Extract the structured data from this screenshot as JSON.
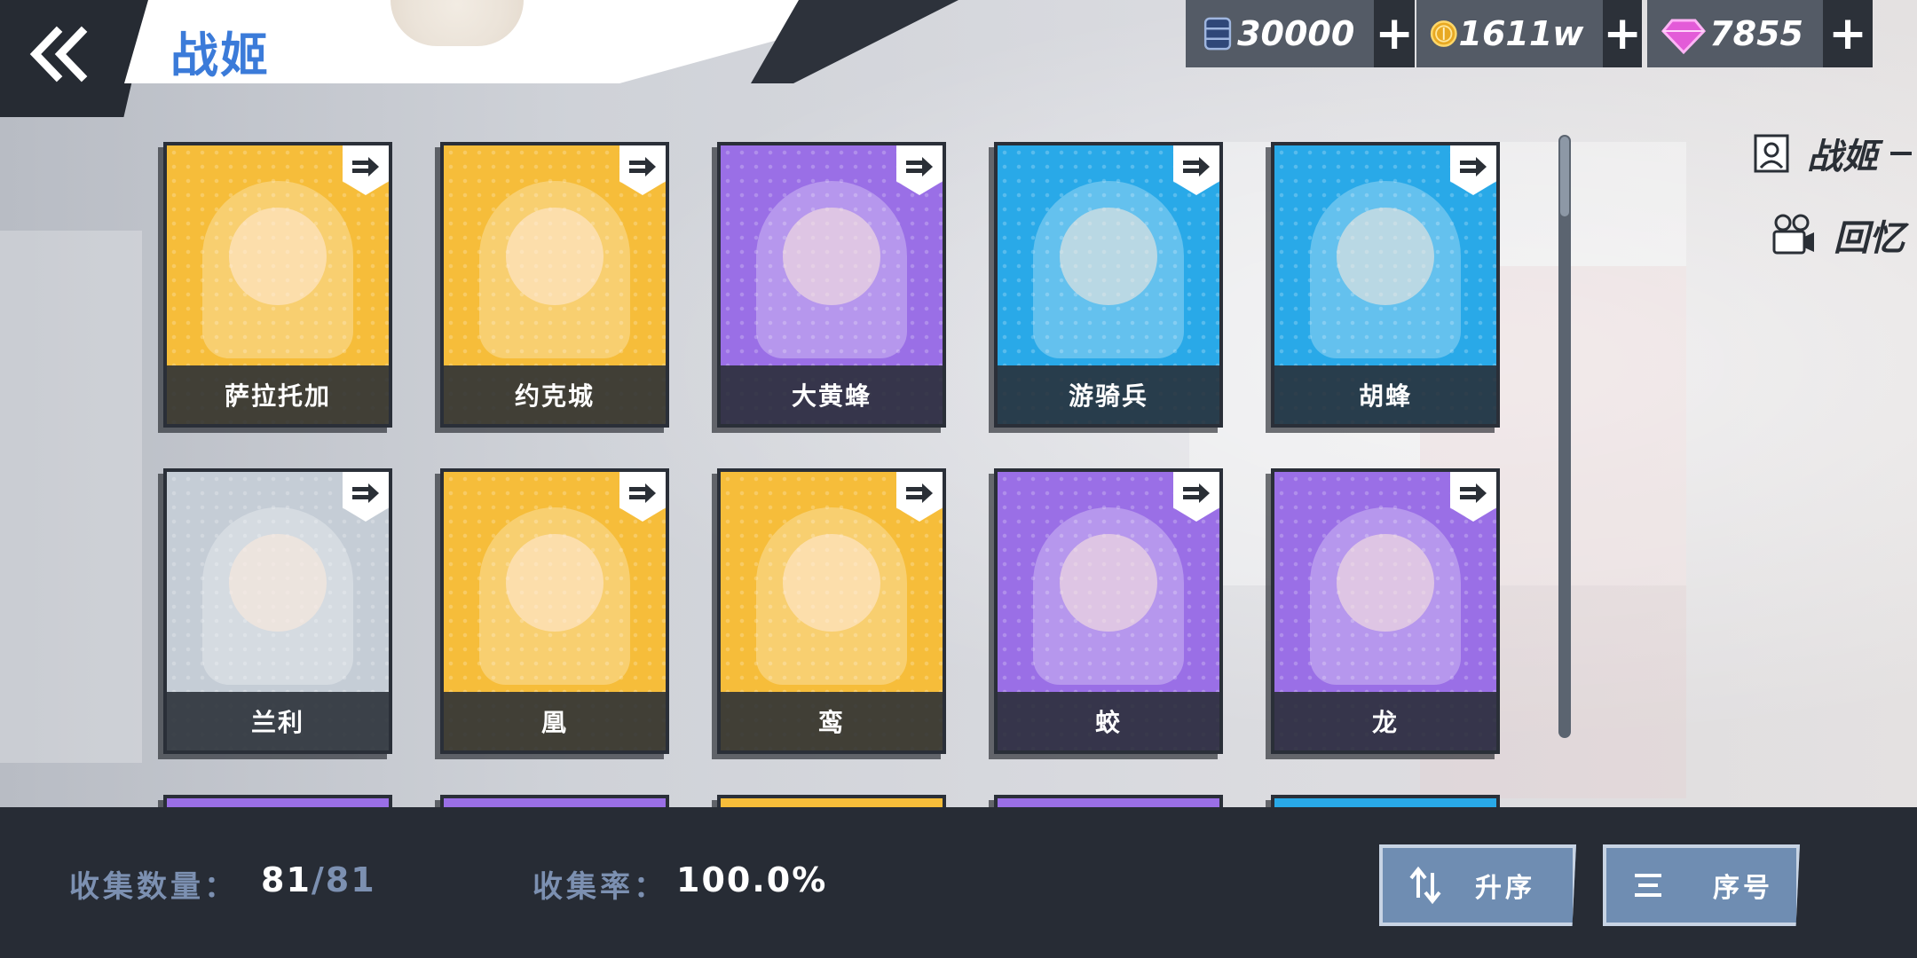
{
  "header": {
    "title": "战姬"
  },
  "currencies": [
    {
      "icon": "fuel-barrel-icon",
      "value": "30000",
      "plus": "+"
    },
    {
      "icon": "gold-anchor-coin-icon",
      "value": "1611w",
      "plus": "+"
    },
    {
      "icon": "pink-gem-icon",
      "value": "7855",
      "plus": "+"
    }
  ],
  "side_nav": [
    {
      "icon": "portrait-frame-icon",
      "label": "战姬"
    },
    {
      "icon": "film-camera-icon",
      "label": "回忆"
    }
  ],
  "cards": [
    {
      "name": "萨拉托加",
      "bg": "#f6bd3a"
    },
    {
      "name": "约克城",
      "bg": "#f6bd3a"
    },
    {
      "name": "大黄蜂",
      "bg": "#9a6fe6"
    },
    {
      "name": "游骑兵",
      "bg": "#29a9e8"
    },
    {
      "name": "胡蜂",
      "bg": "#29a9e8"
    },
    {
      "name": "兰利",
      "bg": "#c5cdd6"
    },
    {
      "name": "凰",
      "bg": "#f6bd3a"
    },
    {
      "name": "鸾",
      "bg": "#f6bd3a"
    },
    {
      "name": "蛟",
      "bg": "#9a6fe6"
    },
    {
      "name": "龙",
      "bg": "#9a6fe6"
    }
  ],
  "footer": {
    "collect_count_label": "收集数量：",
    "collect_count": "81",
    "collect_total": "/81",
    "collect_rate_label": "收集率：",
    "collect_rate": "100.0%",
    "sort_button": "升序",
    "sort_icon": "sort-arrows-icon",
    "order_button": "序号",
    "order_icon": "list-lines-icon"
  }
}
